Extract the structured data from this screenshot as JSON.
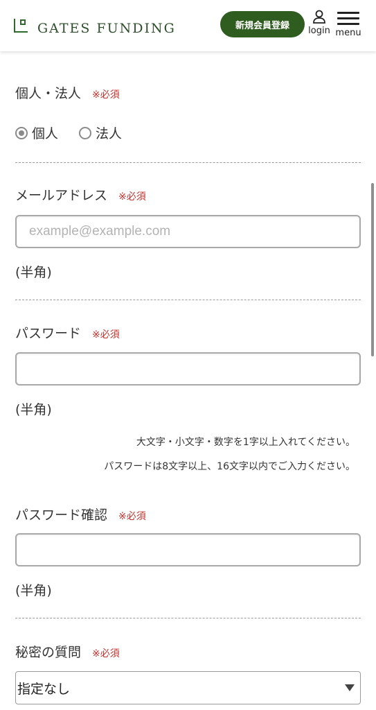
{
  "header": {
    "logo_text": "GATES FUNDING",
    "signup_label": "新規会員登録",
    "login_label": "login",
    "menu_label": "menu",
    "brand_color": "#2e5d1f"
  },
  "form": {
    "required_mark": "※必須",
    "entity_type": {
      "label": "個人・法人",
      "options": [
        {
          "label": "個人",
          "selected": true
        },
        {
          "label": "法人",
          "selected": false
        }
      ]
    },
    "email": {
      "label": "メールアドレス",
      "placeholder": "example@example.com",
      "value": "",
      "note": "(半角)"
    },
    "password": {
      "label": "パスワード",
      "value": "",
      "note": "(半角)",
      "hint_1": "大文字・小文字・数字を1字以上入れてください。",
      "hint_2": "パスワードは8文字以上、16文字以内でご入力ください。"
    },
    "password_confirm": {
      "label": "パスワード確認",
      "value": "",
      "note": "(半角)"
    },
    "secret_question": {
      "label": "秘密の質問",
      "selected": "指定なし"
    }
  }
}
